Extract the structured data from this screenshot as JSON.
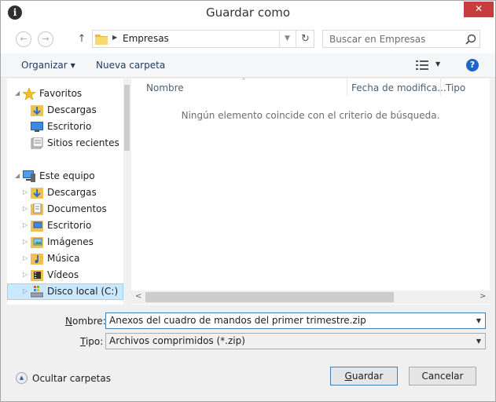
{
  "window": {
    "title": "Guardar como",
    "title_icon_glyph": "i",
    "close_glyph": "✕"
  },
  "navbar": {
    "back_glyph": "←",
    "forward_glyph": "→",
    "up_glyph": "↑",
    "address_arrow": "▶",
    "address_folder": "Empresas",
    "address_dropdown_glyph": "▼",
    "refresh_glyph": "↻",
    "search_placeholder": "Buscar en Empresas"
  },
  "toolbar": {
    "organize_label": "Organizar",
    "organize_caret": "▼",
    "new_folder_label": "Nueva carpeta",
    "view_caret": "▼",
    "help_glyph": "?"
  },
  "nav_pane": {
    "items": [
      {
        "label": "Favoritos",
        "icon": "star-icon",
        "expander": "◢"
      },
      {
        "label": "Descargas",
        "icon": "downloads-icon"
      },
      {
        "label": "Escritorio",
        "icon": "desktop-icon"
      },
      {
        "label": "Sitios recientes",
        "icon": "recent-places-icon"
      },
      {
        "label": "Este equipo",
        "icon": "computer-icon",
        "expander": "◢"
      },
      {
        "label": "Descargas",
        "icon": "downloads-icon",
        "expander": "▷"
      },
      {
        "label": "Documentos",
        "icon": "documents-icon",
        "expander": "▷"
      },
      {
        "label": "Escritorio",
        "icon": "desktop-folder-icon",
        "expander": "▷"
      },
      {
        "label": "Imágenes",
        "icon": "pictures-icon",
        "expander": "▷"
      },
      {
        "label": "Música",
        "icon": "music-icon",
        "expander": "▷"
      },
      {
        "label": "Vídeos",
        "icon": "videos-icon",
        "expander": "▷"
      },
      {
        "label": "Disco local (C:)",
        "icon": "drive-icon",
        "expander": "▷"
      }
    ]
  },
  "file_pane": {
    "columns": [
      "Nombre",
      "Fecha de modifica...",
      "Tipo"
    ],
    "sort_glyph": "^",
    "empty_message": "Ningún elemento coincide con el criterio de búsqueda.",
    "scroll_left_glyph": "<",
    "scroll_right_glyph": ">"
  },
  "form": {
    "name_label_key": "N",
    "name_label_rest": "ombre:",
    "name_value": "Anexos del cuadro de mandos del primer trimestre.zip",
    "type_label_key": "T",
    "type_label_rest": "ipo:",
    "type_value": "Archivos comprimidos (*.zip)",
    "dropdown_glyph": "▼"
  },
  "footer": {
    "hide_folders_label": "Ocultar carpetas",
    "hide_folders_glyph": "▲",
    "save_key": "G",
    "save_rest": "uardar",
    "cancel_label": "Cancelar"
  },
  "colors": {
    "close_button": "#c73c3c",
    "selection_background": "#cce8ff",
    "help_icon": "#1e64c8"
  }
}
